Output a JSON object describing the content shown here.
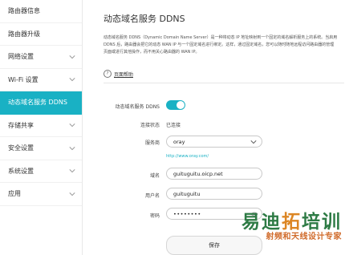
{
  "sidebar": {
    "items": [
      {
        "label": "路由器信息",
        "chevron": false,
        "active": false
      },
      {
        "label": "路由器升级",
        "chevron": false,
        "active": false
      },
      {
        "label": "网络设置",
        "chevron": true,
        "active": false
      },
      {
        "label": "Wi-Fi 设置",
        "chevron": true,
        "active": false
      },
      {
        "label": "动态域名服务 DDNS",
        "chevron": false,
        "active": true
      },
      {
        "label": "存储共享",
        "chevron": true,
        "active": false
      },
      {
        "label": "安全设置",
        "chevron": true,
        "active": false
      },
      {
        "label": "系统设置",
        "chevron": true,
        "active": false
      },
      {
        "label": "应用",
        "chevron": true,
        "active": false
      }
    ]
  },
  "main": {
    "title": "动态域名服务 DDNS",
    "description": "动态域名服务 DDNS（Dynamic Domain Name Server）是一种将动态 IP 地址映射到一个固定的域名解析服务上的系统。当启用 DDNS 后，路由器会把它的动态 WAN IP 与一个固定域名进行绑定。这样，通过固定域名，您可以随时随地远程访问路由器的管理页面或进行其他操作，而不用关心路由器的 WAN IP。",
    "help_label": "页面帮助",
    "help_icon": "question-icon"
  },
  "form": {
    "ddns_label": "动态域名服务 DDNS",
    "ddns_enabled": true,
    "status_label": "连接状态",
    "status_value": "已连接",
    "provider_label": "服务商",
    "provider_value": "oray",
    "provider_link": "http://www.oray.com/",
    "domain_label": "域名",
    "domain_value": "guituguitu.oicp.net",
    "username_label": "用户名",
    "username_value": "guituguitu",
    "password_label": "密码",
    "password_value": "••••••••",
    "save_label": "保存"
  },
  "watermark": {
    "brand_part1": "易迪",
    "brand_part2": "拓",
    "brand_part3": "培训",
    "tagline": "射频和天线设计专家"
  },
  "colors": {
    "accent": "#19b1c4",
    "watermark_green": "#2e7b45",
    "watermark_orange": "#dc8624"
  }
}
